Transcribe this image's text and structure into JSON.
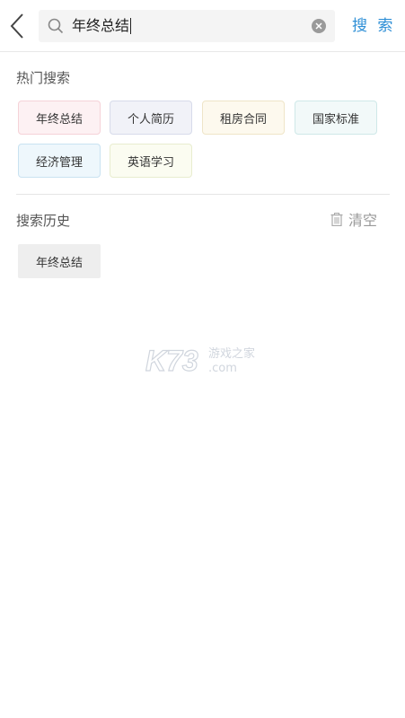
{
  "header": {
    "search_value": "年终总结",
    "search_button_label": "搜 索"
  },
  "hot_search": {
    "title": "热门搜索",
    "tags": [
      {
        "label": "年终总结",
        "bg": "#fdf1f3",
        "border": "#f5d2d8"
      },
      {
        "label": "个人简历",
        "bg": "#f1f2f8",
        "border": "#d7dbea"
      },
      {
        "label": "租房合同",
        "bg": "#fdf9ee",
        "border": "#efe5c8"
      },
      {
        "label": "国家标准",
        "bg": "#f2f9f9",
        "border": "#cfe8e8"
      },
      {
        "label": "经济管理",
        "bg": "#eef7fc",
        "border": "#c9e2f1"
      },
      {
        "label": "英语学习",
        "bg": "#fbfcf1",
        "border": "#e8edcf"
      }
    ]
  },
  "history": {
    "title": "搜索历史",
    "clear_label": "清空",
    "items": [
      {
        "label": "年终总结",
        "bg": "#eeeeee"
      }
    ]
  },
  "watermark": {
    "logo_text": "K73",
    "tagline": "游戏之家",
    "domain": ".com"
  },
  "icons": [
    "back-arrow-icon",
    "search-icon",
    "clear-icon",
    "trash-icon"
  ],
  "colors": {
    "accent": "#2e8fd6"
  }
}
